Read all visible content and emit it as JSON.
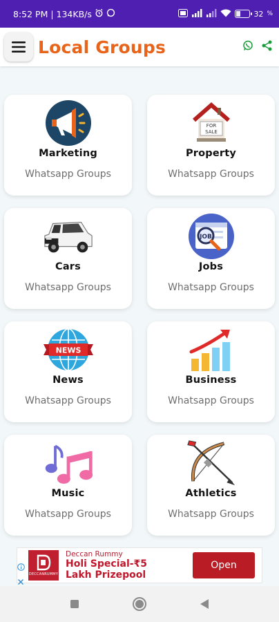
{
  "status_bar": {
    "time_net": "8:52 PM | 134KB/s",
    "battery": "32"
  },
  "header": {
    "title": "Local Groups"
  },
  "categories": [
    {
      "name": "Marketing",
      "subtitle": "Whatsapp Groups",
      "icon": "megaphone-icon"
    },
    {
      "name": "Property",
      "subtitle": "Whatsapp Groups",
      "icon": "house-for-sale-icon"
    },
    {
      "name": "Cars",
      "subtitle": "Whatsapp Groups",
      "icon": "suv-car-icon"
    },
    {
      "name": "Jobs",
      "subtitle": "Whatsapp Groups",
      "icon": "job-search-icon"
    },
    {
      "name": "News",
      "subtitle": "Whatsapp Groups",
      "icon": "news-globe-icon"
    },
    {
      "name": "Business",
      "subtitle": "Whatsapp Groups",
      "icon": "growth-chart-icon"
    },
    {
      "name": "Music",
      "subtitle": "Whatsapp Groups",
      "icon": "music-notes-icon"
    },
    {
      "name": "Athletics",
      "subtitle": "Whatsapp Groups",
      "icon": "bow-arrow-icon"
    }
  ],
  "ad": {
    "brand": "Deccan Rummy",
    "headline": "Holi Special-₹5 Lakh Prizepool",
    "logo_text": "DECCANRUMMY",
    "cta": "Open"
  },
  "colors": {
    "status_bar": "#4e1fb1",
    "title": "#e8641a",
    "whatsapp": "#25a244",
    "share": "#1a9b3c",
    "ad_button": "#b91c24"
  }
}
